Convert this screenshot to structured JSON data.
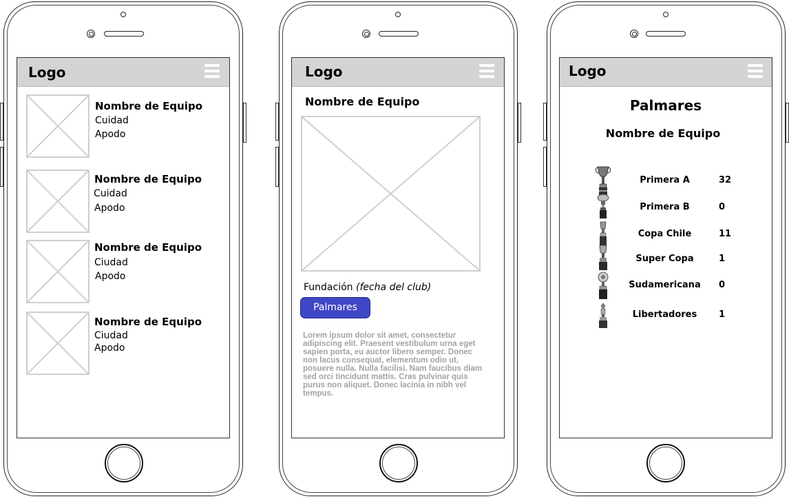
{
  "common": {
    "logo": "Logo"
  },
  "list_screen": {
    "teams": [
      {
        "name": "Nombre de Equipo",
        "city": "Cuidad",
        "nickname": "Apodo"
      },
      {
        "name": "Nombre de Equipo",
        "city": "Cuidad",
        "nickname": "Apodo"
      },
      {
        "name": "Nombre de Equipo",
        "city": "Ciudad",
        "nickname": "Apodo"
      },
      {
        "name": "Nombre de Equipo",
        "city": "Ciudad",
        "nickname": "Apodo"
      }
    ]
  },
  "detail_screen": {
    "team_name": "Nombre de Equipo",
    "founding_label": "Fundación",
    "founding_value": "(fecha del club)",
    "palmares_button": "Palmares",
    "lorem": "Lorem ipsum dolor sit amet, consectetur adipiscing elit. Praesent vestibulum urna eget sapien porta, eu auctor libero semper. Donec non lacus consequat, elementum odio ut, posuere nulla. Nulla facilisi. Nam faucibus diam sed orci tincidunt mattis. Cras pulvinar quis purus non aliquet. Donec lacinia in nibh vel tempus."
  },
  "palmares_screen": {
    "title": "Palmares",
    "team_name": "Nombre de Equipo",
    "titles": [
      {
        "competition": "Primera A",
        "count": "32"
      },
      {
        "competition": "Primera B",
        "count": "0"
      },
      {
        "competition": "Copa Chile",
        "count": "11"
      },
      {
        "competition": "Super Copa",
        "count": "1"
      },
      {
        "competition": "Sudamericana",
        "count": "0"
      },
      {
        "competition": "Libertadores",
        "count": "1"
      }
    ]
  }
}
